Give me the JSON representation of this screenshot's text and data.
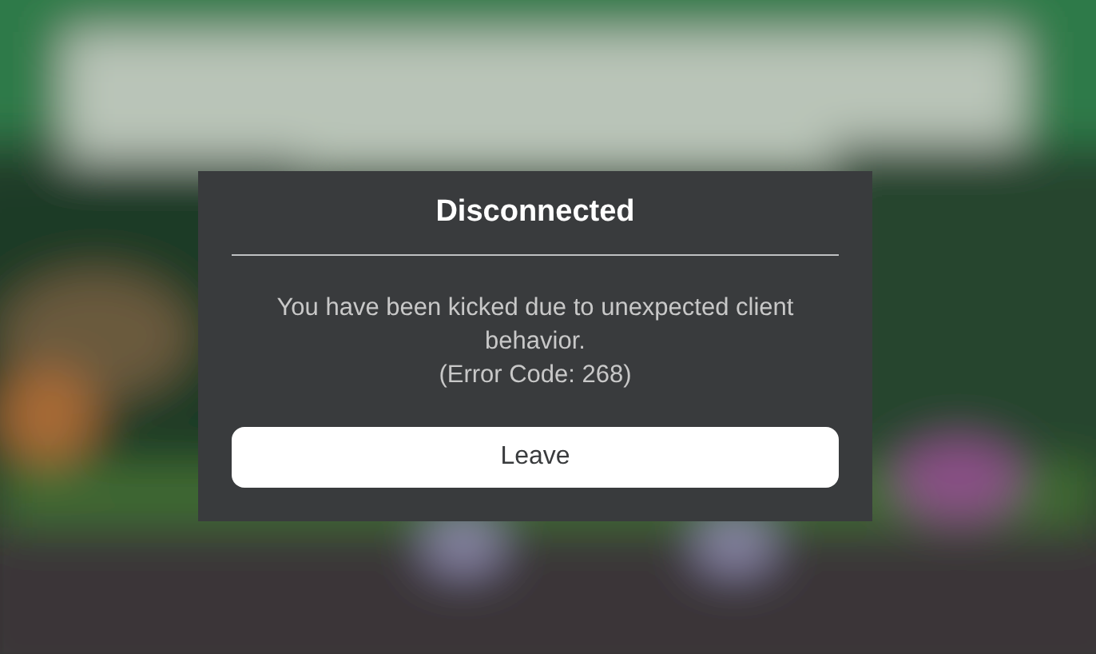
{
  "dialog": {
    "title": "Disconnected",
    "message": "You have been kicked due to unexpected client behavior.",
    "error_code": "(Error Code: 268)",
    "buttons": [
      "Leave"
    ]
  }
}
